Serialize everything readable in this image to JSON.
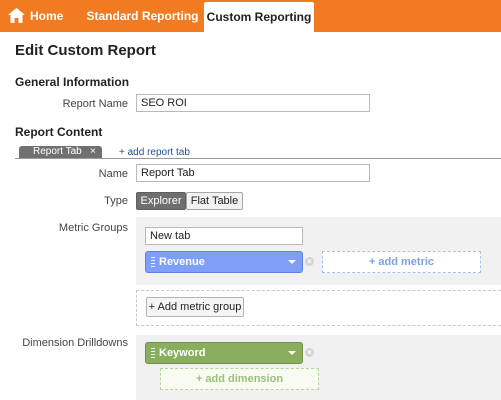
{
  "nav": {
    "home": "Home",
    "standard": "Standard Reporting",
    "custom": "Custom Reporting"
  },
  "page_title": "Edit Custom Report",
  "general": {
    "heading": "General Information",
    "report_name_label": "Report Name",
    "report_name_value": "SEO ROI"
  },
  "content": {
    "heading": "Report Content",
    "tab_label": "Report Tab",
    "tab_close": "×",
    "add_tab": "+ add report tab",
    "name_label": "Name",
    "name_value": "Report Tab",
    "type_label": "Type",
    "type_options": [
      "Explorer",
      "Flat Table"
    ],
    "type_selected": "Explorer",
    "metric_groups_label": "Metric Groups",
    "metric_group_name": "New tab",
    "metric_chip": "Revenue",
    "add_metric": "+ add metric",
    "add_metric_group": "+ Add metric group",
    "dimension_label": "Dimension Drilldowns",
    "dimension_chip": "Keyword",
    "add_dimension": "+ add dimension",
    "remove_glyph": "×"
  },
  "colors": {
    "nav_orange": "#f27b21",
    "metric_blue": "#7e9ef7",
    "dimension_green": "#8aae5d",
    "link_blue": "#1f4f9c"
  },
  "icons": {
    "home": "home-icon",
    "caret": "chevron-down-icon",
    "remove": "close-icon",
    "grip": "drag-handle-icon"
  }
}
